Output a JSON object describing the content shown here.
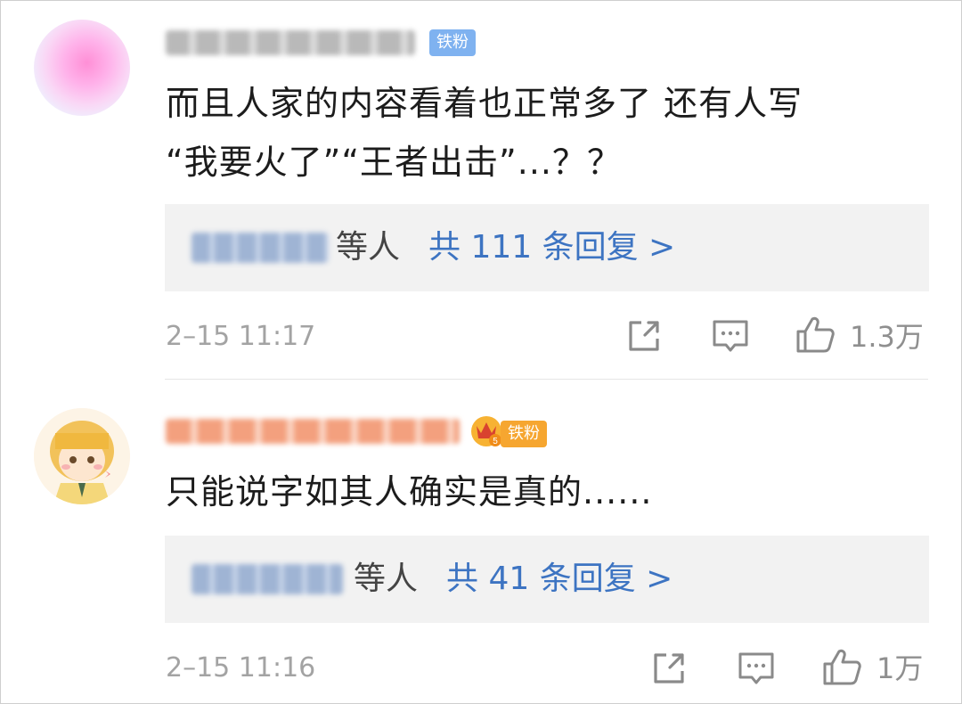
{
  "comments": [
    {
      "badge": "铁粉",
      "text_line1": "而且人家的内容看着也正常多了 还有人写",
      "text_line2": "“我要火了”“王者出击”...？？",
      "reply_suffix": "等人",
      "reply_count_label": "共 111 条回复 >",
      "time": "2–15 11:17",
      "like_count": "1.3万",
      "icons": [
        "share-icon",
        "comment-icon",
        "like-icon"
      ]
    },
    {
      "badge": "铁粉",
      "text_line1": "只能说字如其人确实是真的......",
      "reply_suffix": "等人",
      "reply_count_label": "共 41 条回复 >",
      "time": "2–15 11:16",
      "like_count": "1万",
      "icons": [
        "share-icon",
        "comment-icon",
        "like-icon"
      ]
    }
  ],
  "colors": {
    "link_blue": "#3d74c2",
    "badge_blue": "#7fb2f0",
    "badge_orange": "#f6a630",
    "meta_gray": "#a3a3a3"
  }
}
